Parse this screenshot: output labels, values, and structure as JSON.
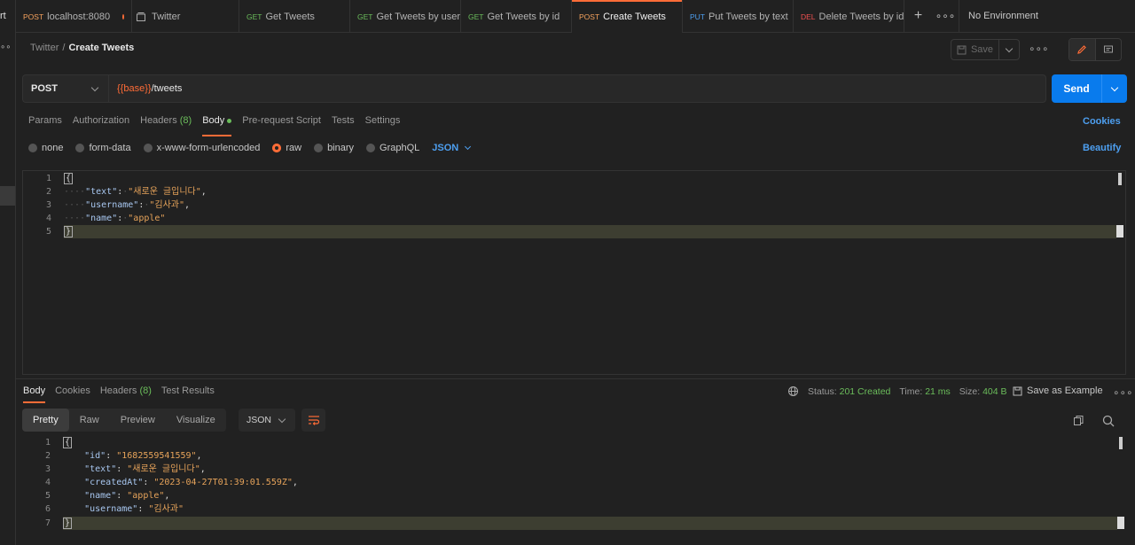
{
  "sidebar": {
    "title_fragment": "rt",
    "more": "∘∘"
  },
  "tabs": [
    {
      "method": "POST",
      "label": "localhost:8080",
      "unsaved": true
    },
    {
      "method": "",
      "label": "Twitter",
      "icon": "collection-icon"
    },
    {
      "method": "GET",
      "label": "Get Tweets"
    },
    {
      "method": "GET",
      "label": "Get Tweets by usern"
    },
    {
      "method": "GET",
      "label": "Get Tweets by id"
    },
    {
      "method": "POST",
      "label": "Create Tweets",
      "active": true
    },
    {
      "method": "PUT",
      "label": "Put Tweets by text"
    },
    {
      "method": "DEL",
      "label": "Delete Tweets by id"
    }
  ],
  "tab_more": "∘∘∘",
  "environment": {
    "label": "No Environment"
  },
  "breadcrumb": {
    "parent": "Twitter",
    "separator": "/",
    "current": "Create Tweets"
  },
  "toolbar": {
    "save_label": "Save",
    "more": "∘∘∘"
  },
  "request": {
    "method": "POST",
    "url_var": "{{base}}",
    "url_path": "/tweets",
    "send_label": "Send"
  },
  "request_tabs": {
    "params": "Params",
    "authorization": "Authorization",
    "headers": "Headers",
    "headers_count": "(8)",
    "body": "Body",
    "prerequest": "Pre-request Script",
    "tests": "Tests",
    "settings": "Settings",
    "cookies": "Cookies"
  },
  "body_types": {
    "none": "none",
    "form_data": "form-data",
    "urlencoded": "x-www-form-urlencoded",
    "raw": "raw",
    "binary": "binary",
    "graphql": "GraphQL",
    "format": "JSON",
    "beautify": "Beautify"
  },
  "request_body": {
    "line_numbers": [
      "1",
      "2",
      "3",
      "4",
      "5"
    ],
    "open": "{",
    "close": "}",
    "fields": [
      {
        "key": "\"text\"",
        "value": "\"새로운 글입니다\"",
        "comma": ","
      },
      {
        "key": "\"username\"",
        "value": "\"김사과\"",
        "comma": ","
      },
      {
        "key": "\"name\"",
        "value": "\"apple\"",
        "comma": ""
      }
    ]
  },
  "response_tabs": {
    "body": "Body",
    "cookies": "Cookies",
    "headers": "Headers",
    "headers_count": "(8)",
    "test_results": "Test Results"
  },
  "response_status": {
    "status_label": "Status:",
    "status_value": "201 Created",
    "time_label": "Time:",
    "time_value": "21 ms",
    "size_label": "Size:",
    "size_value": "404 B",
    "save_example": "Save as Example",
    "more": "∘∘∘"
  },
  "response_view": {
    "pretty": "Pretty",
    "raw": "Raw",
    "preview": "Preview",
    "visualize": "Visualize",
    "format": "JSON"
  },
  "response_body": {
    "line_numbers": [
      "1",
      "2",
      "3",
      "4",
      "5",
      "6",
      "7"
    ],
    "open": "{",
    "close": "}",
    "fields": [
      {
        "key": "\"id\"",
        "value": "\"1682559541559\"",
        "comma": ","
      },
      {
        "key": "\"text\"",
        "value": "\"새로운 글입니다\"",
        "comma": ","
      },
      {
        "key": "\"createdAt\"",
        "value": "\"2023-04-27T01:39:01.559Z\"",
        "comma": ","
      },
      {
        "key": "\"name\"",
        "value": "\"apple\"",
        "comma": ","
      },
      {
        "key": "\"username\"",
        "value": "\"김사과\"",
        "comma": ""
      }
    ]
  },
  "colors": {
    "accent": "#ff6c37",
    "primary": "#097bed",
    "success": "#6bbd5b",
    "background": "#212121"
  }
}
